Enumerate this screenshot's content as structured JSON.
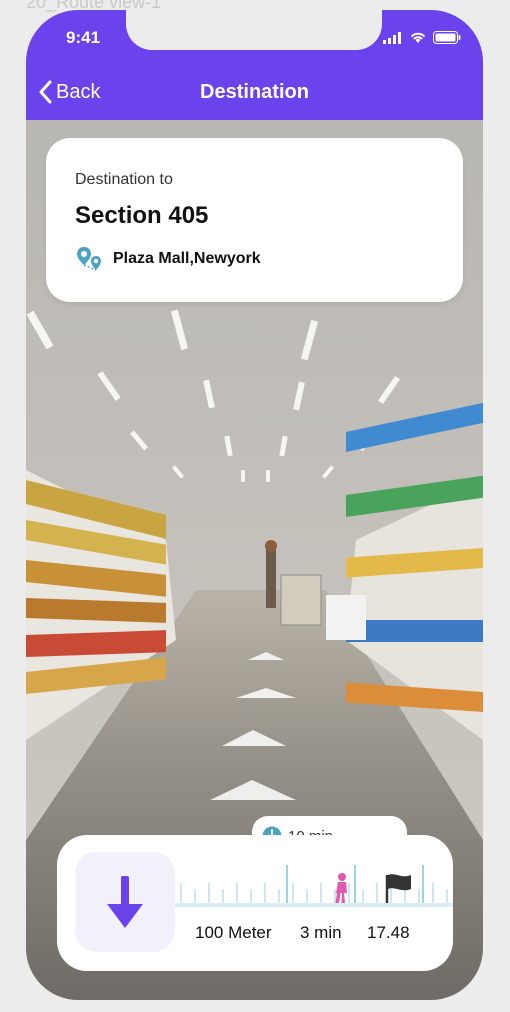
{
  "frame_label": "20_Route view-1",
  "status": {
    "time": "9:41"
  },
  "header": {
    "back_label": "Back",
    "title": "Destination"
  },
  "destination": {
    "label": "Destination to",
    "section": "Section 405",
    "location": "Plaza Mall,Newyork"
  },
  "eta": {
    "duration": "10 min"
  },
  "navigation": {
    "distance": "100 Meter",
    "time": "3 min",
    "value": "17.48"
  },
  "colors": {
    "accent": "#6b43ec",
    "walker": "#e05ab0",
    "teal": "#4aa3c3"
  }
}
